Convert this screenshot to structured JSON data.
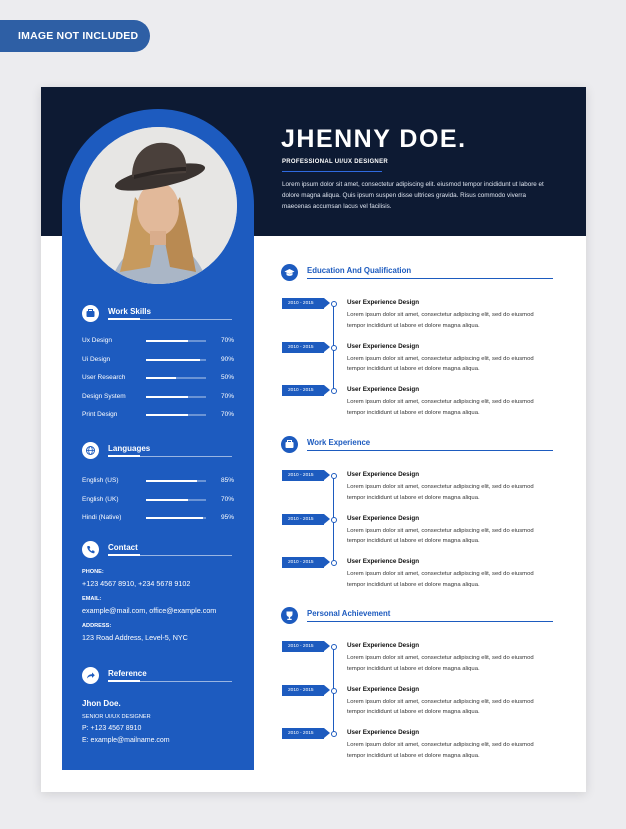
{
  "badge": "IMAGE NOT INCLUDED",
  "header": {
    "name": "JHENNY DOE.",
    "role": "PROFESSIONAL UI/UX DESIGNER",
    "summary": "Lorem ipsum dolor sit amet, consectetur adipiscing elit. eiusmod tempor incididunt ut labore et dolore magna aliqua. Quis ipsum suspen disse ultrices gravida. Risus commodo viverra maecenas accumsan lacus vel facilisis."
  },
  "sidebar": {
    "work_skills": {
      "title": "Work Skills",
      "icon": "briefcase-icon",
      "items": [
        {
          "label": "Ux Design",
          "pct_text": "70%",
          "level": 0.7
        },
        {
          "label": "Ui Design",
          "pct_text": "90%",
          "level": 0.9
        },
        {
          "label": "User Research",
          "pct_text": "50%",
          "level": 0.5
        },
        {
          "label": "Design System",
          "pct_text": "70%",
          "level": 0.7
        },
        {
          "label": "Print Design",
          "pct_text": "70%",
          "level": 0.7
        }
      ]
    },
    "languages": {
      "title": "Languages",
      "icon": "globe-icon",
      "items": [
        {
          "label": "English (US)",
          "pct_text": "85%",
          "level": 0.85
        },
        {
          "label": "English (UK)",
          "pct_text": "70%",
          "level": 0.7
        },
        {
          "label": "Hindi (Native)",
          "pct_text": "95%",
          "level": 0.95
        }
      ]
    },
    "contact": {
      "title": "Contact",
      "icon": "phone-icon",
      "phone_label": "PHONE:",
      "phone": "+123 4567 8910,  +234 5678 9102",
      "email_label": "EMAIL:",
      "email": "example@mail.com, office@example.com",
      "address_label": "ADDRESS:",
      "address": "123 Road Address, Level-5, NYC"
    },
    "reference": {
      "title": "Reference",
      "icon": "share-icon",
      "name": "Jhon Doe.",
      "role": "SENIOR UI/UX DESIGNER",
      "phone": "P: +123 4567 8910",
      "email": "E: example@mailname.com"
    }
  },
  "main": {
    "education": {
      "title": "Education And Qualification",
      "icon": "graduation-cap-icon",
      "entries": [
        {
          "date": "2010 - 2015",
          "title": "User Experience Design",
          "desc": "Lorem ipsum dolor sit amet, consectetur adipiscing elit, sed do eiusmod tempor incididunt ut labore et dolore magna aliqua."
        },
        {
          "date": "2010 - 2015",
          "title": "User Experience Design",
          "desc": "Lorem ipsum dolor sit amet, consectetur adipiscing elit, sed do eiusmod tempor incididunt ut labore et dolore magna aliqua."
        },
        {
          "date": "2010 - 2015",
          "title": "User Experience Design",
          "desc": "Lorem ipsum dolor sit amet, consectetur adipiscing elit, sed do eiusmod tempor incididunt ut labore et dolore magna aliqua."
        }
      ]
    },
    "work": {
      "title": "Work Experience",
      "icon": "briefcase-icon",
      "entries": [
        {
          "date": "2010 - 2015",
          "title": "User Experience Design",
          "desc": "Lorem ipsum dolor sit amet, consectetur adipiscing elit, sed do eiusmod tempor incididunt ut labore et dolore magna aliqua."
        },
        {
          "date": "2010 - 2015",
          "title": "User Experience Design",
          "desc": "Lorem ipsum dolor sit amet, consectetur adipiscing elit, sed do eiusmod tempor incididunt ut labore et dolore magna aliqua."
        },
        {
          "date": "2010 - 2015",
          "title": "User Experience Design",
          "desc": "Lorem ipsum dolor sit amet, consectetur adipiscing elit, sed do eiusmod tempor incididunt ut labore et dolore magna aliqua."
        }
      ]
    },
    "achievement": {
      "title": "Personal Achievement",
      "icon": "trophy-icon",
      "entries": [
        {
          "date": "2010 - 2015",
          "title": "User Experience Design",
          "desc": "Lorem ipsum dolor sit amet, consectetur adipiscing elit, sed do eiusmod tempor incididunt ut labore et dolore magna aliqua."
        },
        {
          "date": "2010 - 2015",
          "title": "User Experience Design",
          "desc": "Lorem ipsum dolor sit amet, consectetur adipiscing elit, sed do eiusmod tempor incididunt ut labore et dolore magna aliqua."
        },
        {
          "date": "2010 - 2015",
          "title": "User Experience Design",
          "desc": "Lorem ipsum dolor sit amet, consectetur adipiscing elit, sed do eiusmod tempor incididunt ut labore et dolore magna aliqua."
        }
      ]
    }
  },
  "colors": {
    "navy": "#0d1a33",
    "accent": "#1d5bbf",
    "page": "#ececef"
  }
}
